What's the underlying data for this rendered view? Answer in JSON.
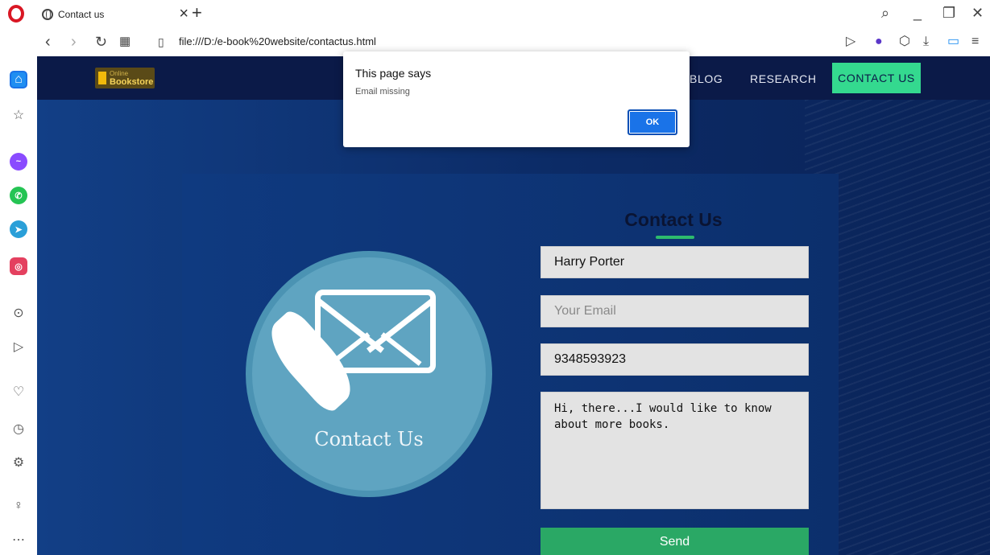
{
  "browser": {
    "tab_title": "Contact us",
    "tab_close": "×",
    "new_tab": "+",
    "url": "file:///D:/e-book%20website/contactus.html",
    "colors": {
      "opera_red": "#d91724",
      "sidebar_active": "#1f8ef1"
    }
  },
  "site": {
    "logo": {
      "line1": "Online",
      "line2": "Bookstore"
    },
    "nav": {
      "blog": "BLOG",
      "research": "RESEARCH",
      "contact": "CONTACT US"
    },
    "colors": {
      "nav_bg": "#0b1a48",
      "accent": "#34d98f",
      "send": "#2aa865"
    }
  },
  "contact": {
    "illustration_label": "Contact Us",
    "form_title": "Contact Us",
    "name_value": "Harry Porter",
    "email_value": "",
    "email_placeholder": "Your Email",
    "phone_value": "9348593923",
    "message_value": "Hi, there...I would like to know about more books.",
    "send_label": "Send"
  },
  "dialog": {
    "title": "This page says",
    "message": "Email missing",
    "ok_label": "OK"
  }
}
